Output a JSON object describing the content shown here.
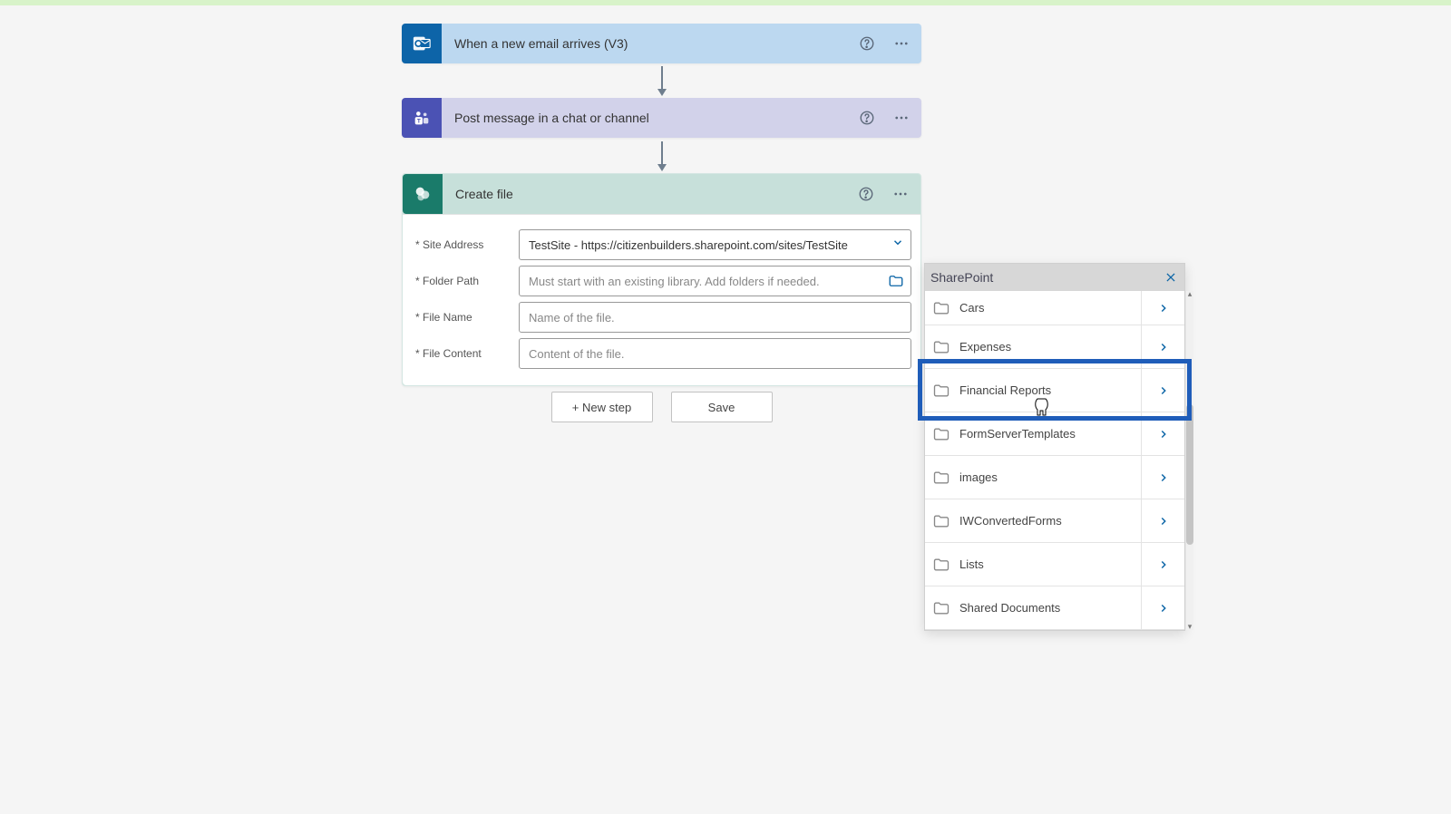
{
  "triggers": {
    "outlook": {
      "title": "When a new email arrives (V3)"
    },
    "teams": {
      "title": "Post message in a chat or channel"
    }
  },
  "createFile": {
    "title": "Create file",
    "fields": {
      "siteAddress": {
        "label": "* Site Address",
        "value": "TestSite - https://citizenbuilders.sharepoint.com/sites/TestSite"
      },
      "folderPath": {
        "label": "* Folder Path",
        "placeholder": "Must start with an existing library. Add folders if needed."
      },
      "fileName": {
        "label": "* File Name",
        "placeholder": "Name of the file."
      },
      "fileContent": {
        "label": "* File Content",
        "placeholder": "Content of the file."
      }
    }
  },
  "footer": {
    "newStep": "+ New step",
    "save": "Save"
  },
  "picker": {
    "title": "SharePoint",
    "items": [
      "Cars",
      "Expenses",
      "Financial Reports",
      "FormServerTemplates",
      "images",
      "IWConvertedForms",
      "Lists",
      "Shared Documents"
    ]
  }
}
